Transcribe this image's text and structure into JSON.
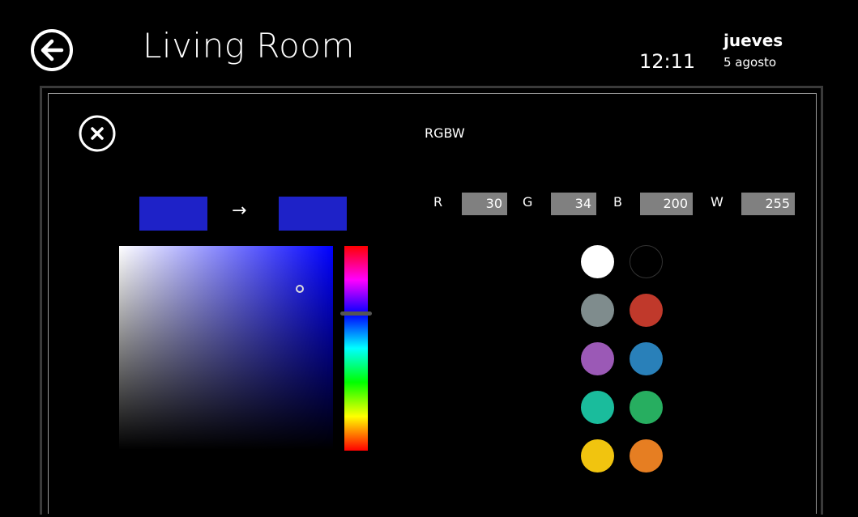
{
  "header": {
    "title": "Living Room",
    "time": "12:11",
    "weekday": "jueves",
    "date": "5 agosto",
    "back_icon": "arrow-left-circle-icon"
  },
  "panel": {
    "title": "RGBW",
    "close_icon": "close-circle-icon"
  },
  "color_picker": {
    "previous_color": "#1e22c8",
    "new_color": "#1e22c8",
    "arrow": "→",
    "hue_base": "#0000ff"
  },
  "channels": {
    "r_label": "R",
    "r_value": "30",
    "g_label": "G",
    "g_value": "34",
    "b_label": "B",
    "b_value": "200",
    "w_label": "W",
    "w_value": "255"
  },
  "presets": [
    "#ffffff",
    "#000000",
    "#7f8c8d",
    "#c0392b",
    "#9b59b6",
    "#2980b9",
    "#1abc9c",
    "#27ae60",
    "#f1c40f",
    "#e67e22"
  ]
}
